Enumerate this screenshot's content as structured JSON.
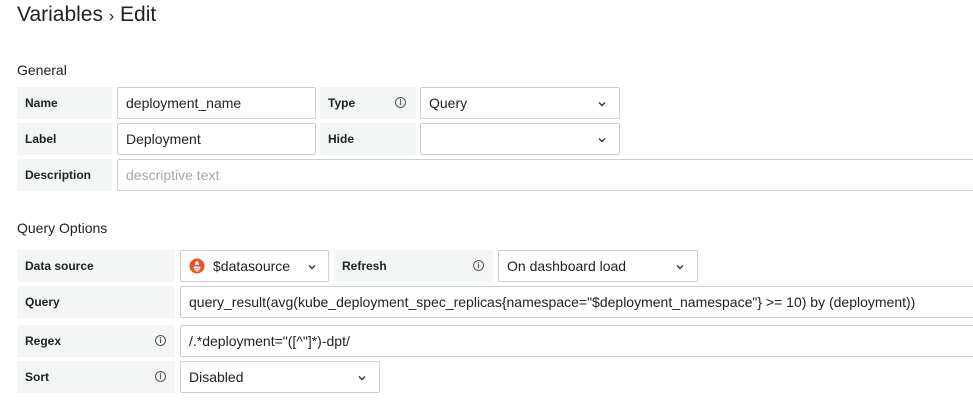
{
  "page": {
    "title_main": "Variables",
    "title_sep": "›",
    "title_sub": "Edit"
  },
  "general": {
    "title": "General",
    "name_label": "Name",
    "name_value": "deployment_name",
    "type_label": "Type",
    "type_value": "Query",
    "label_label": "Label",
    "label_value": "Deployment",
    "hide_label": "Hide",
    "hide_value": "",
    "description_label": "Description",
    "description_placeholder": "descriptive text"
  },
  "query_options": {
    "title": "Query Options",
    "datasource_label": "Data source",
    "datasource_value": "$datasource",
    "refresh_label": "Refresh",
    "refresh_value": "On dashboard load",
    "query_label": "Query",
    "query_value": "query_result(avg(kube_deployment_spec_replicas{namespace=\"$deployment_namespace\"} >= 10) by (deployment))",
    "regex_label": "Regex",
    "regex_value": "/.*deployment=\"([^\"]*)-dpt/",
    "sort_label": "Sort",
    "sort_value": "Disabled"
  },
  "icons": {
    "info": "info-circle-icon",
    "chevron": "chevron-down-icon",
    "datasource": "prometheus-logo-icon"
  },
  "colors": {
    "label_bg": "#f4f5f5",
    "border": "#c7d0d9",
    "prometheus": "#e6522c"
  }
}
